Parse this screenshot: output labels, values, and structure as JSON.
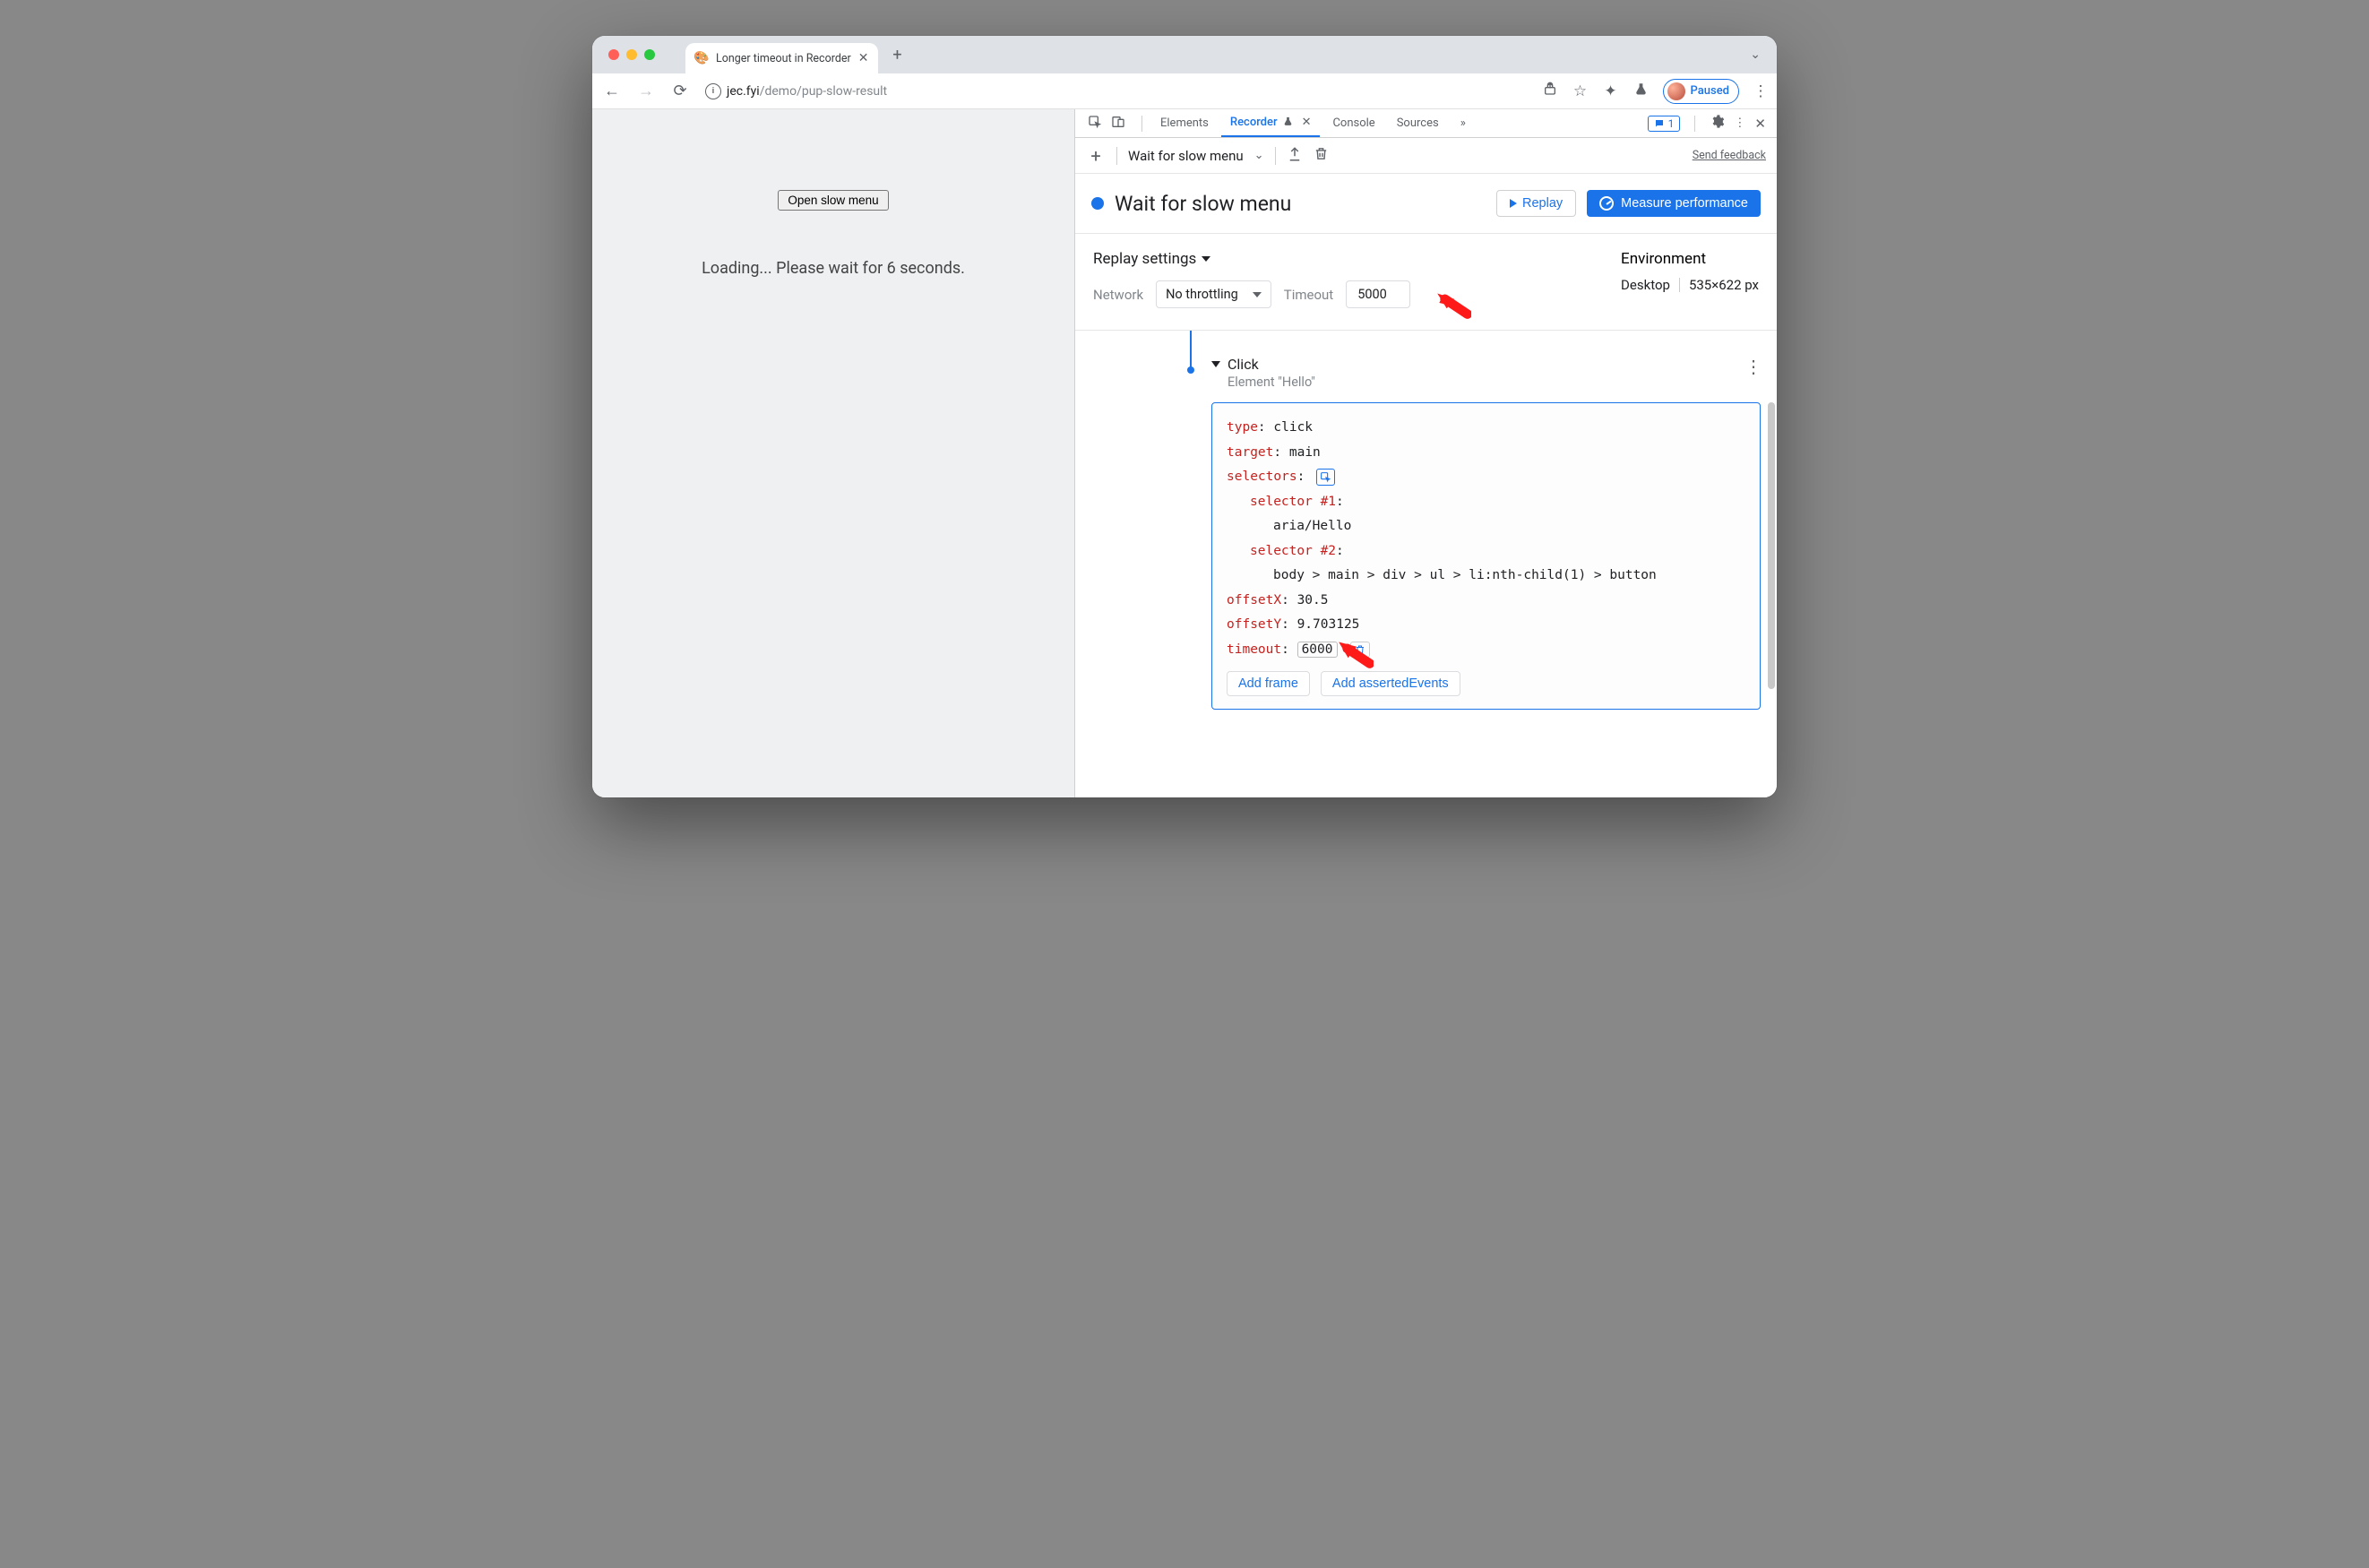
{
  "browser": {
    "tab": {
      "title": "Longer timeout in Recorder"
    },
    "url": {
      "host": "jec.fyi",
      "path": "/demo/pup-slow-result"
    },
    "paused_label": "Paused"
  },
  "page": {
    "open_button": "Open slow menu",
    "loading_text": "Loading... Please wait for 6 seconds."
  },
  "devtools": {
    "tabs": {
      "elements": "Elements",
      "recorder": "Recorder",
      "console": "Console",
      "sources": "Sources"
    },
    "issues_count": "1",
    "actionbar": {
      "recording_name": "Wait for slow menu",
      "feedback": "Send feedback"
    },
    "title_row": {
      "title": "Wait for slow menu",
      "replay": "Replay",
      "measure": "Measure performance"
    },
    "settings": {
      "heading": "Replay settings",
      "network_label": "Network",
      "network_value": "No throttling",
      "timeout_label": "Timeout",
      "timeout_value": "5000",
      "env_heading": "Environment",
      "env_device": "Desktop",
      "env_dims": "535×622 px"
    },
    "step": {
      "name": "Click",
      "subtitle": "Element \"Hello\"",
      "type_key": "type",
      "type_val": "click",
      "target_key": "target",
      "target_val": "main",
      "selectors_key": "selectors",
      "selector1_key": "selector #1",
      "selector1_val": "aria/Hello",
      "selector2_key": "selector #2",
      "selector2_val": "body > main > div > ul > li:nth-child(1) > button",
      "offsetX_key": "offsetX",
      "offsetX_val": "30.5",
      "offsetY_key": "offsetY",
      "offsetY_val": "9.703125",
      "timeout_key": "timeout",
      "timeout_val": "6000",
      "add_frame": "Add frame",
      "add_asserted": "Add assertedEvents"
    }
  }
}
